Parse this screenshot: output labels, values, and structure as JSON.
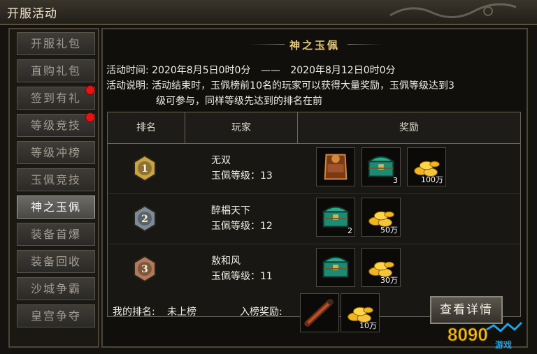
{
  "window": {
    "title": "开服活动"
  },
  "sidebar": {
    "items": [
      {
        "label": "开服礼包",
        "active": false,
        "dot": false
      },
      {
        "label": "直购礼包",
        "active": false,
        "dot": false
      },
      {
        "label": "签到有礼",
        "active": false,
        "dot": true
      },
      {
        "label": "等级竞技",
        "active": false,
        "dot": true
      },
      {
        "label": "等级冲榜",
        "active": false,
        "dot": false
      },
      {
        "label": "玉佩竞技",
        "active": false,
        "dot": false
      },
      {
        "label": "神之玉佩",
        "active": true,
        "dot": false
      },
      {
        "label": "装备首爆",
        "active": false,
        "dot": false
      },
      {
        "label": "装备回收",
        "active": false,
        "dot": false
      },
      {
        "label": "沙城争霸",
        "active": false,
        "dot": false
      },
      {
        "label": "皇宫争夺",
        "active": false,
        "dot": false
      }
    ]
  },
  "panel": {
    "title": "神之玉佩",
    "time_label": "活动时间:",
    "time_start": "2020年8月5日0时0分",
    "time_sep": "——",
    "time_end": "2020年8月12日0时0分",
    "desc_label": "活动说明:",
    "desc_line1": "活动结束时，玉佩榜前10名的玩家可以获得大量奖励，玉佩等级达到3",
    "desc_line2": "级可参与，同样等级先达到的排名在前"
  },
  "table": {
    "headers": {
      "rank": "排名",
      "player": "玩家",
      "reward": "奖励"
    },
    "rows": [
      {
        "rank": "1",
        "name": "无双",
        "level": "玉佩等级：13",
        "rewards": [
          {
            "icon": "wushuang-token-icon",
            "count": ""
          },
          {
            "icon": "jade-chest-icon",
            "count": "3"
          },
          {
            "icon": "gold-ingots-icon",
            "count": "100万"
          }
        ]
      },
      {
        "rank": "2",
        "name": "醉椙天下",
        "level": "玉佩等级：12",
        "rewards": [
          {
            "icon": "jade-chest-icon",
            "count": "2"
          },
          {
            "icon": "gold-ingots-icon",
            "count": "50万"
          }
        ]
      },
      {
        "rank": "3",
        "name": "敖和风",
        "level": "玉佩等级：11",
        "rewards": [
          {
            "icon": "jade-chest-icon",
            "count": ""
          },
          {
            "icon": "gold-ingots-icon",
            "count": "30万"
          }
        ]
      }
    ],
    "medal_colors": [
      "#c9a245",
      "#7d8a97",
      "#b07a5c"
    ]
  },
  "footer": {
    "my_rank_label": "我的排名:",
    "my_rank_value": "未上榜",
    "entry_reward_label": "入榜奖励:",
    "entry_rewards": [
      {
        "icon": "scroll-icon",
        "count": ""
      },
      {
        "icon": "gold-ingots-icon",
        "count": "10万"
      }
    ],
    "detail_button": "查看详情"
  },
  "watermark": {
    "text": "8090",
    "sub": "游戏"
  }
}
